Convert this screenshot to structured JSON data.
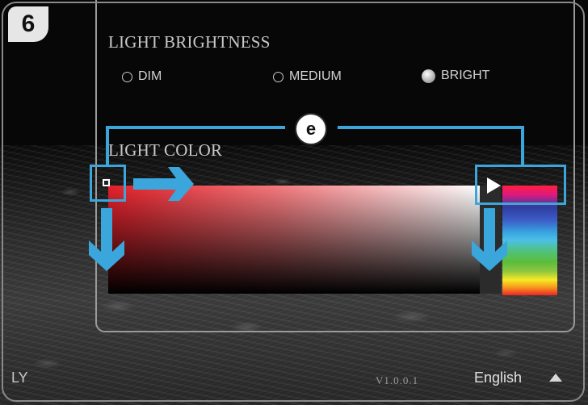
{
  "step_badge": "6",
  "callout_badge": "e",
  "brightness": {
    "title": "LIGHT BRIGHTNESS",
    "options": [
      {
        "label": "DIM",
        "selected": false
      },
      {
        "label": "MEDIUM",
        "selected": false
      },
      {
        "label": "BRIGHT",
        "selected": true
      }
    ]
  },
  "color": {
    "title": "LIGHT COLOR"
  },
  "footer": {
    "left_text": "LY",
    "version": "V1.0.0.1",
    "language": "English"
  },
  "colors": {
    "annotation": "#3aa6dc",
    "gradient_start": "#e4202a"
  },
  "icons": {
    "language_dropdown": "triangle-up-icon",
    "picker_cursor": "square-cursor-icon",
    "hue_marker": "play-arrow-icon"
  }
}
